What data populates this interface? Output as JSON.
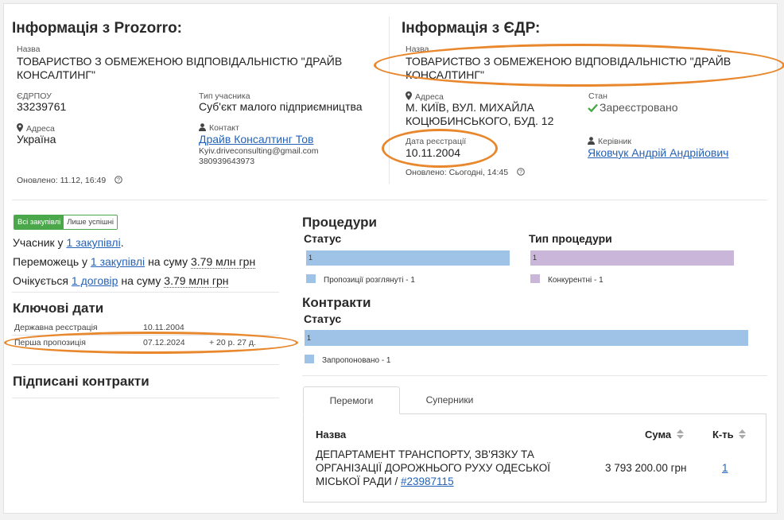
{
  "prozorro": {
    "title": "Інформація з Prozorro:",
    "name_label": "Назва",
    "name_value": "ТОВАРИСТВО З ОБМЕЖЕНОЮ ВІДПОВІДАЛЬНІСТЮ \"ДРАЙВ КОНСАЛТИНГ\"",
    "edrpou_label": "ЄДРПОУ",
    "edrpou_value": "33239761",
    "type_label": "Тип учасника",
    "type_value": "Суб'єкт малого підприємництва",
    "address_label": "Адреса",
    "address_value": "Україна",
    "contact_label": "Контакт",
    "contact_name": "Драйв Консалтинг Тов",
    "contact_email": "Kyiv.driveconsulting@gmail.com",
    "contact_phone": "380939643973",
    "updated": "Оновлено: 11.12, 16:49"
  },
  "edr": {
    "title": "Інформація з ЄДР:",
    "name_label": "Назва",
    "name_value": "ТОВАРИСТВО З ОБМЕЖЕНОЮ ВІДПОВІДАЛЬНІСТЮ \"ДРАЙВ КОНСАЛТИНГ\"",
    "address_label": "Адреса",
    "address_value": "М. КИЇВ, ВУЛ. МИХАЙЛА КОЦЮБИНСЬКОГО, БУД. 12",
    "state_label": "Стан",
    "state_value": "Зареєстровано",
    "reg_date_label": "Дата реєстрації",
    "reg_date_value": "10.11.2004",
    "head_label": "Керівник",
    "head_value": "Яковчук Андрій Андрійович",
    "updated": "Оновлено: Сьогодні, 14:45"
  },
  "filter": {
    "all": "Всі закупівлі",
    "success": "Лише успішні"
  },
  "stats": {
    "participant_prefix": "Учасник у",
    "participant_link": "1 закупівлі",
    "participant_suffix": ".",
    "winner_prefix": "Переможець у",
    "winner_link": "1 закупівлі",
    "winner_mid": "на суму",
    "winner_sum": "3.79 млн грн",
    "expected_prefix": "Очікується",
    "expected_link": "1 договір",
    "expected_mid": "на суму",
    "expected_sum": "3.79 млн грн"
  },
  "key_dates": {
    "title": "Ключові дати",
    "rows": [
      {
        "label": "Державна реєстрація",
        "date": "10.11.2004",
        "extra": ""
      },
      {
        "label": "Перша пропозиція",
        "date": "07.12.2024",
        "extra": "+ 20 р. 27 д."
      }
    ]
  },
  "signed": {
    "title": "Підписані контракти"
  },
  "procedures": {
    "title": "Процедури",
    "status_title": "Статус",
    "status_bar_value": "1",
    "status_legend": "Пропозиції розглянуті - 1",
    "type_title": "Тип процедури",
    "type_bar_value": "1",
    "type_legend": "Конкурентні - 1"
  },
  "contracts": {
    "title": "Контракти",
    "status_title": "Статус",
    "bar_value": "1",
    "legend": "Запропоновано - 1"
  },
  "colors": {
    "blue": "#9fc2e7",
    "purple": "#c9b6d8",
    "accent_green": "#4aa84a",
    "oval": "#e8872c"
  },
  "tabs": {
    "wins": "Перемоги",
    "rivals": "Суперники"
  },
  "table": {
    "col_name": "Назва",
    "col_sum": "Сума",
    "col_count": "К-ть",
    "rows": [
      {
        "name": "ДЕПАРТАМЕНТ ТРАНСПОРТУ, ЗВ'ЯЗКУ ТА ОРГАНІЗАЦІЇ ДОРОЖНЬОГО РУХУ ОДЕСЬКОЇ МІСЬКОЇ РАДИ /",
        "id_link": "#23987115",
        "sum": "3 793 200.00 грн",
        "count": "1"
      }
    ]
  }
}
